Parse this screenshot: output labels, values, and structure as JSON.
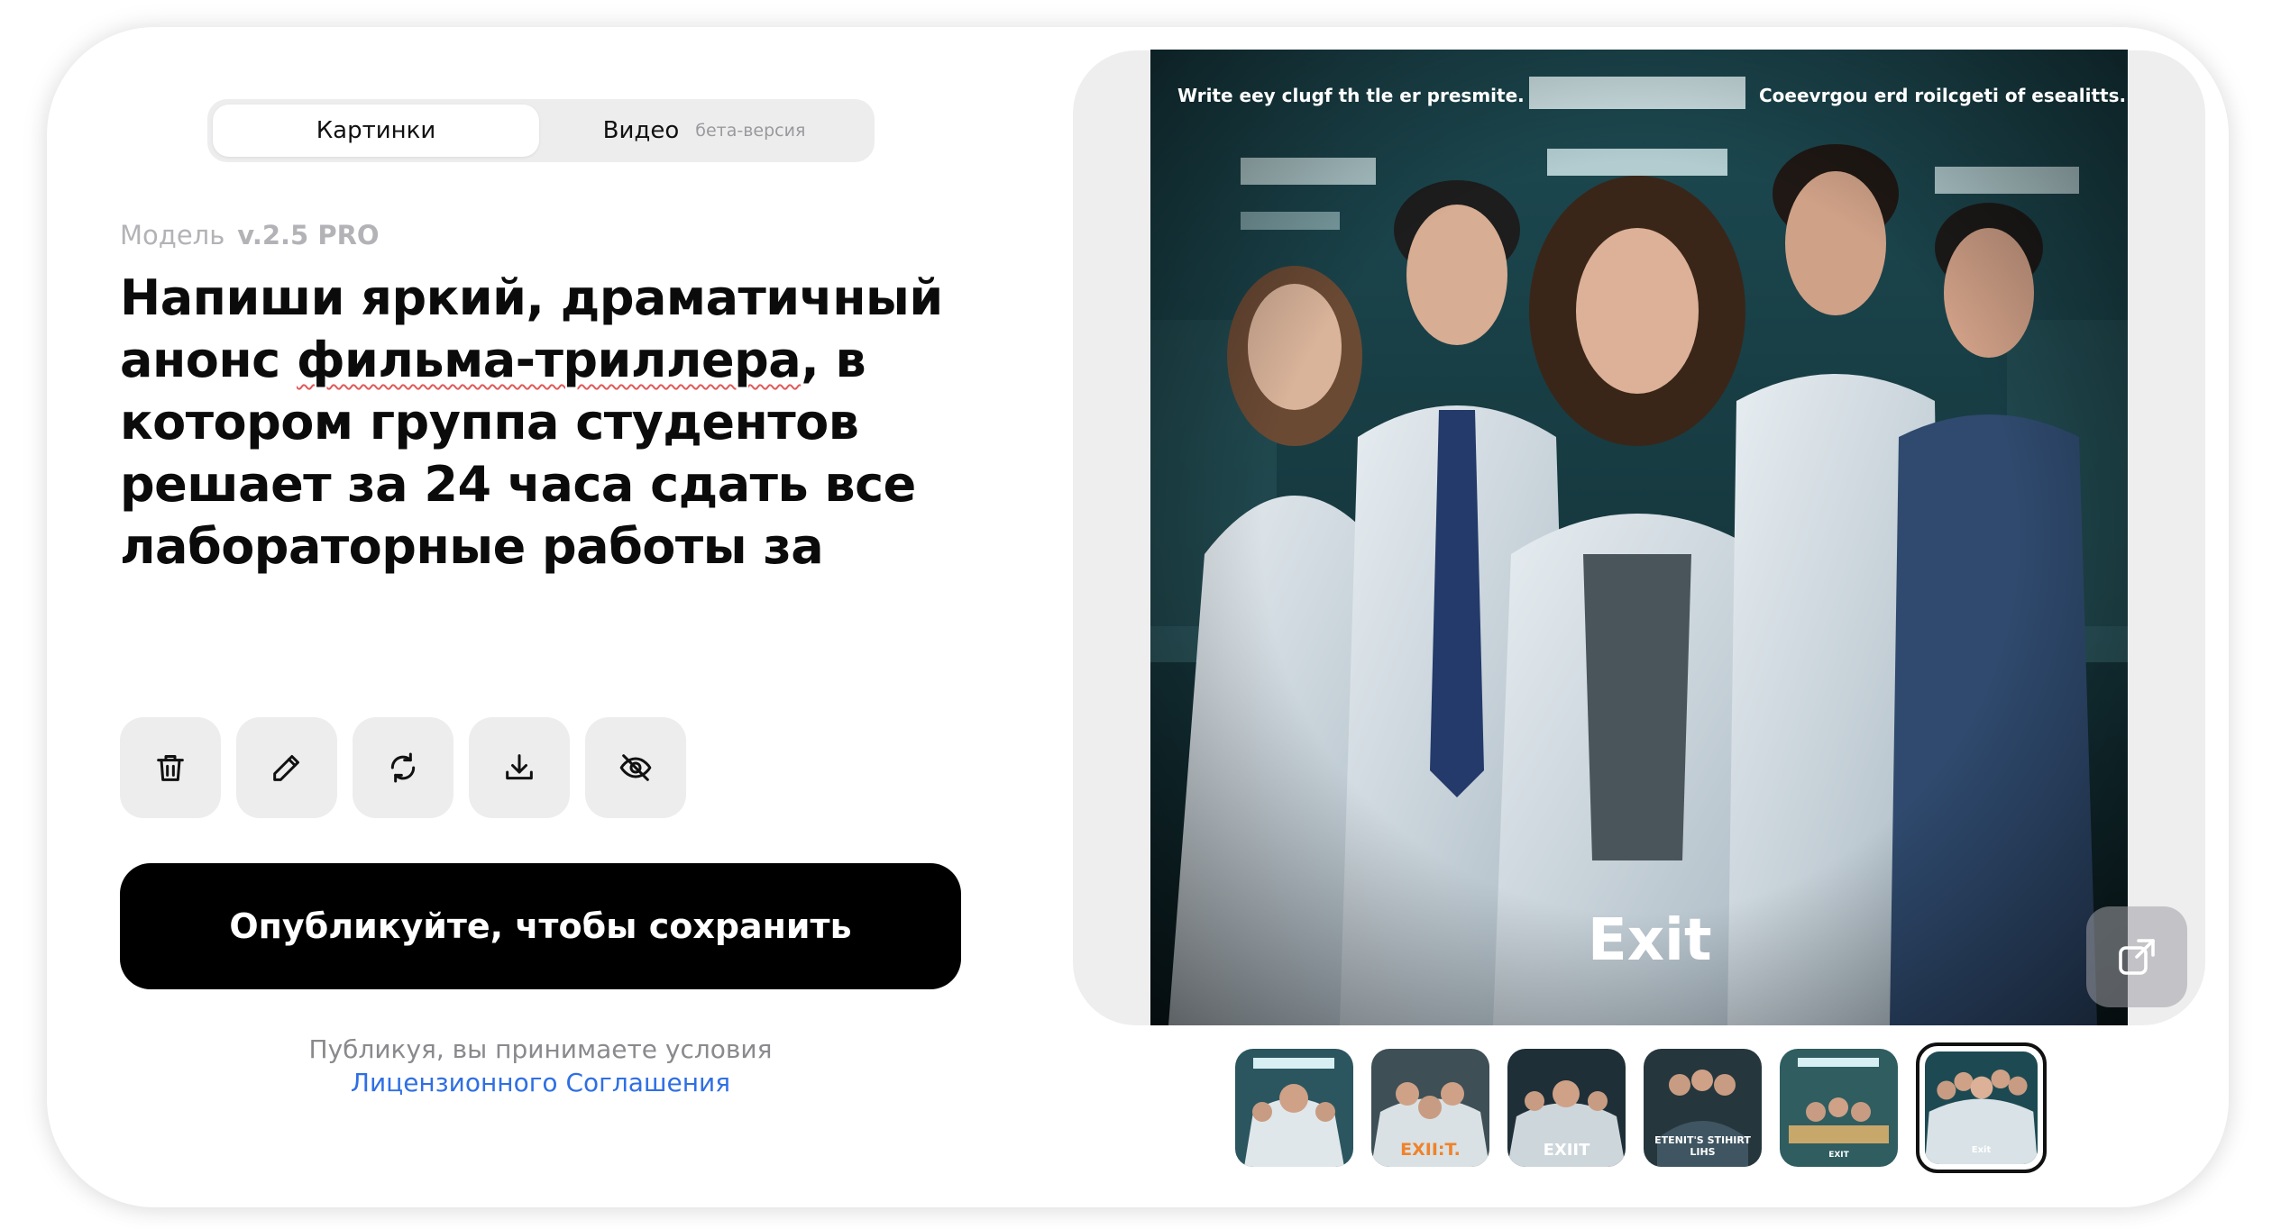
{
  "tabs": {
    "images": "Картинки",
    "video": "Видео",
    "video_badge": "бета-версия"
  },
  "model": {
    "label": "Модель",
    "version": "v.2.5 PRO"
  },
  "prompt": {
    "underlined": "фильма-триллера",
    "before": "Напиши яркий, драматичный анонс ",
    "after": ", в котором группа студентов решает за 24 часа сдать все лабораторные работы за"
  },
  "actions": [
    {
      "name": "delete",
      "icon": "trash-icon"
    },
    {
      "name": "edit",
      "icon": "pencil-icon"
    },
    {
      "name": "regenerate",
      "icon": "refresh-icon"
    },
    {
      "name": "download",
      "icon": "download-icon"
    },
    {
      "name": "hide",
      "icon": "eye-off-icon"
    }
  ],
  "publish_button": "Опубликуйте, чтобы сохранить",
  "terms": {
    "text": "Публикуя, вы принимаете условия",
    "link": "Лицензионного Соглашения"
  },
  "poster": {
    "caption_left": "Write eey clugf th tle er presmite.",
    "caption_right": "Coeevrgou erd roilcgeti of esealitts.",
    "title": "Exit"
  },
  "thumbnails": [
    {
      "label": "",
      "selected": false
    },
    {
      "label": "EXII:T.",
      "selected": false
    },
    {
      "label": "EXIIT",
      "selected": false
    },
    {
      "label": "ETENIT'S STIHIRT LIHS",
      "selected": false
    },
    {
      "label": "EXIT",
      "selected": false
    },
    {
      "label": "Exit",
      "selected": true
    }
  ],
  "colors": {
    "accent_link": "#2f6fe4",
    "button_bg": "#000000",
    "chip_bg": "#ededee"
  }
}
